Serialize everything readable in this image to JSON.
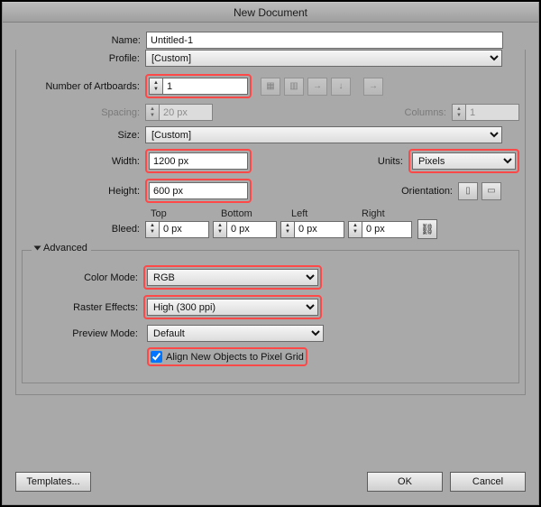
{
  "title": "New Document",
  "name": {
    "label": "Name:",
    "value": "Untitled-1"
  },
  "profile": {
    "label": "Profile:",
    "value": "[Custom]"
  },
  "artboards": {
    "label": "Number of Artboards:",
    "value": "1",
    "arrange_icons": [
      "grid-by-row-icon",
      "grid-by-col-icon",
      "arrange-horizontal-icon",
      "arrange-vertical-icon",
      "arrange-right-icon"
    ]
  },
  "spacing": {
    "label": "Spacing:",
    "value": "20 px"
  },
  "columns": {
    "label": "Columns:",
    "value": "1"
  },
  "size": {
    "label": "Size:",
    "value": "[Custom]"
  },
  "width": {
    "label": "Width:",
    "value": "1200 px"
  },
  "height": {
    "label": "Height:",
    "value": "600 px"
  },
  "units": {
    "label": "Units:",
    "value": "Pixels"
  },
  "orientation": {
    "label": "Orientation:",
    "icons": [
      "portrait-icon",
      "landscape-icon"
    ]
  },
  "bleed": {
    "label": "Bleed:",
    "heads": {
      "top": "Top",
      "bottom": "Bottom",
      "left": "Left",
      "right": "Right"
    },
    "top": "0 px",
    "bottom": "0 px",
    "left": "0 px",
    "right": "0 px",
    "link_icon": "link-icon"
  },
  "advanced": {
    "legend": "Advanced",
    "color_mode": {
      "label": "Color Mode:",
      "value": "RGB"
    },
    "raster_effects": {
      "label": "Raster Effects:",
      "value": "High (300 ppi)"
    },
    "preview_mode": {
      "label": "Preview Mode:",
      "value": "Default"
    },
    "align_pixel_grid": {
      "label": "Align New Objects to Pixel Grid",
      "checked": true
    }
  },
  "buttons": {
    "templates": "Templates...",
    "ok": "OK",
    "cancel": "Cancel"
  }
}
